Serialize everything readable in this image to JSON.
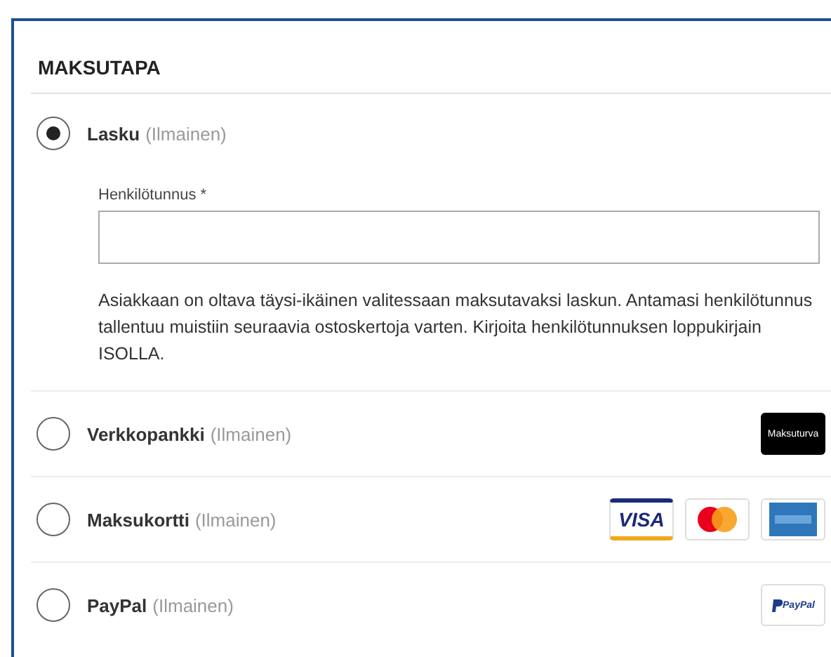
{
  "section": {
    "title": "MAKSUTAPA"
  },
  "methods": [
    {
      "name": "Lasku",
      "price": "(Ilmainen)",
      "selected": true,
      "field": {
        "label": "Henkilötunnus *"
      },
      "description": "Asiakkaan on oltava täysi-ikäinen valitessaan maksutavaksi laskun. Antamasi henkilötunnus tallentuu muistiin seuraavia ostoskertoja varten. Kirjoita henkilötunnuksen loppukirjain ISOLLA."
    },
    {
      "name": "Verkkopankki",
      "price": "(Ilmainen)",
      "selected": false,
      "logos": [
        {
          "kind": "maksuturva",
          "text": "Maksuturva"
        }
      ]
    },
    {
      "name": "Maksukortti",
      "price": "(Ilmainen)",
      "selected": false,
      "logos": [
        {
          "kind": "visa",
          "text": "VISA"
        },
        {
          "kind": "mastercard"
        },
        {
          "kind": "amex"
        }
      ]
    },
    {
      "name": "PayPal",
      "price": "(Ilmainen)",
      "selected": false,
      "logos": [
        {
          "kind": "paypal",
          "text": "PayPal"
        }
      ]
    }
  ]
}
